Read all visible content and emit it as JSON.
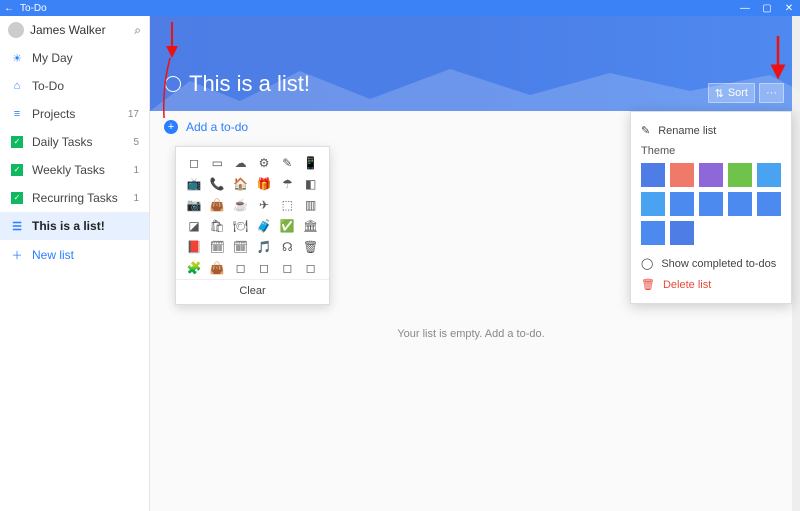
{
  "titlebar": {
    "app_name": "To-Do"
  },
  "user": {
    "name": "James Walker"
  },
  "sidebar": {
    "items": [
      {
        "icon": "sun",
        "label": "My Day",
        "count": ""
      },
      {
        "icon": "home",
        "label": "To-Do",
        "count": ""
      },
      {
        "icon": "list",
        "label": "Projects",
        "count": "17"
      },
      {
        "icon": "check",
        "label": "Daily Tasks",
        "count": "5"
      },
      {
        "icon": "check",
        "label": "Weekly Tasks",
        "count": "1"
      },
      {
        "icon": "check",
        "label": "Recurring Tasks",
        "count": "1"
      },
      {
        "icon": "bullet",
        "label": "This is a list!",
        "count": "",
        "selected": true
      }
    ],
    "new_list_label": "New list"
  },
  "list": {
    "title": "This is a list!",
    "sort_label": "Sort",
    "more_label": "···",
    "add_placeholder": "Add a to-do",
    "empty_message": "Your list is empty. Add a to-do."
  },
  "picker": {
    "clear_label": "Clear",
    "icons": [
      "◻",
      "▭",
      "☁",
      "⚙",
      "✎",
      "📱",
      "📺",
      "📞",
      "🏠",
      "🎁",
      "☂",
      "◧",
      "📷",
      "👜",
      "☕",
      "✈",
      "⬚",
      "▥",
      "◪",
      "🛍",
      "🍽",
      "🧳",
      "✅",
      "🏛",
      "📕",
      "🗓",
      "🗓",
      "🎵",
      "☊",
      "🗑",
      "🧩",
      "👜",
      "◻",
      "◻",
      "◻",
      "◻"
    ]
  },
  "flyout": {
    "rename_label": "Rename list",
    "theme_label": "Theme",
    "swatches": [
      "#4d7de5",
      "#f07a6a",
      "#8e67d8",
      "#6fc24a",
      "#4aa3f0",
      "#4aa3f0",
      "#4d8af0",
      "#4d8af0",
      "#4d8af0",
      "#4d8af0",
      "#4d8af0",
      "#4d7de5"
    ],
    "show_completed_label": "Show completed to-dos",
    "delete_label": "Delete list"
  }
}
